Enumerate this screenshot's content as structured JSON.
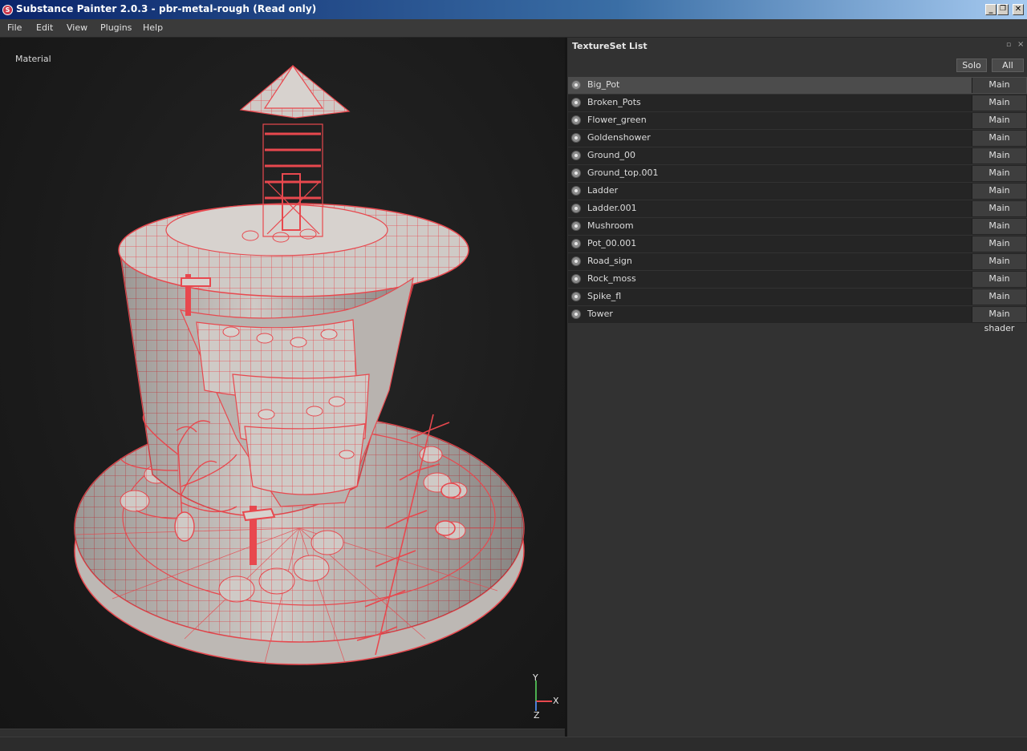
{
  "window": {
    "title": "Substance Painter 2.0.3 - pbr-metal-rough (Read only)",
    "buttons": {
      "minimize": "_",
      "restore": "❐",
      "close": "✕"
    }
  },
  "menu": {
    "items": [
      "File",
      "Edit",
      "View",
      "Plugins",
      "Help"
    ]
  },
  "viewport": {
    "label": "Material",
    "axes": {
      "y": "Y",
      "x": "X",
      "z": "Z"
    }
  },
  "panel": {
    "title": "TextureSet List",
    "solo_label": "Solo",
    "all_label": "All",
    "selected_index": 0,
    "texture_sets": [
      {
        "name": "Big_Pot",
        "shader": "Main shader"
      },
      {
        "name": "Broken_Pots",
        "shader": "Main shader"
      },
      {
        "name": "Flower_green",
        "shader": "Main shader"
      },
      {
        "name": "Goldenshower",
        "shader": "Main shader"
      },
      {
        "name": "Ground_00",
        "shader": "Main shader"
      },
      {
        "name": "Ground_top.001",
        "shader": "Main shader"
      },
      {
        "name": "Ladder",
        "shader": "Main shader"
      },
      {
        "name": "Ladder.001",
        "shader": "Main shader"
      },
      {
        "name": "Mushroom",
        "shader": "Main shader"
      },
      {
        "name": "Pot_00.001",
        "shader": "Main shader"
      },
      {
        "name": "Road_sign",
        "shader": "Main shader"
      },
      {
        "name": "Rock_moss",
        "shader": "Main shader"
      },
      {
        "name": "Spike_fl",
        "shader": "Main shader"
      },
      {
        "name": "Tower",
        "shader": "Main shader"
      }
    ]
  },
  "colors": {
    "wireframe": "#e8484e",
    "mesh": "#cfcac6",
    "title_gradient_start": "#0a246a"
  }
}
